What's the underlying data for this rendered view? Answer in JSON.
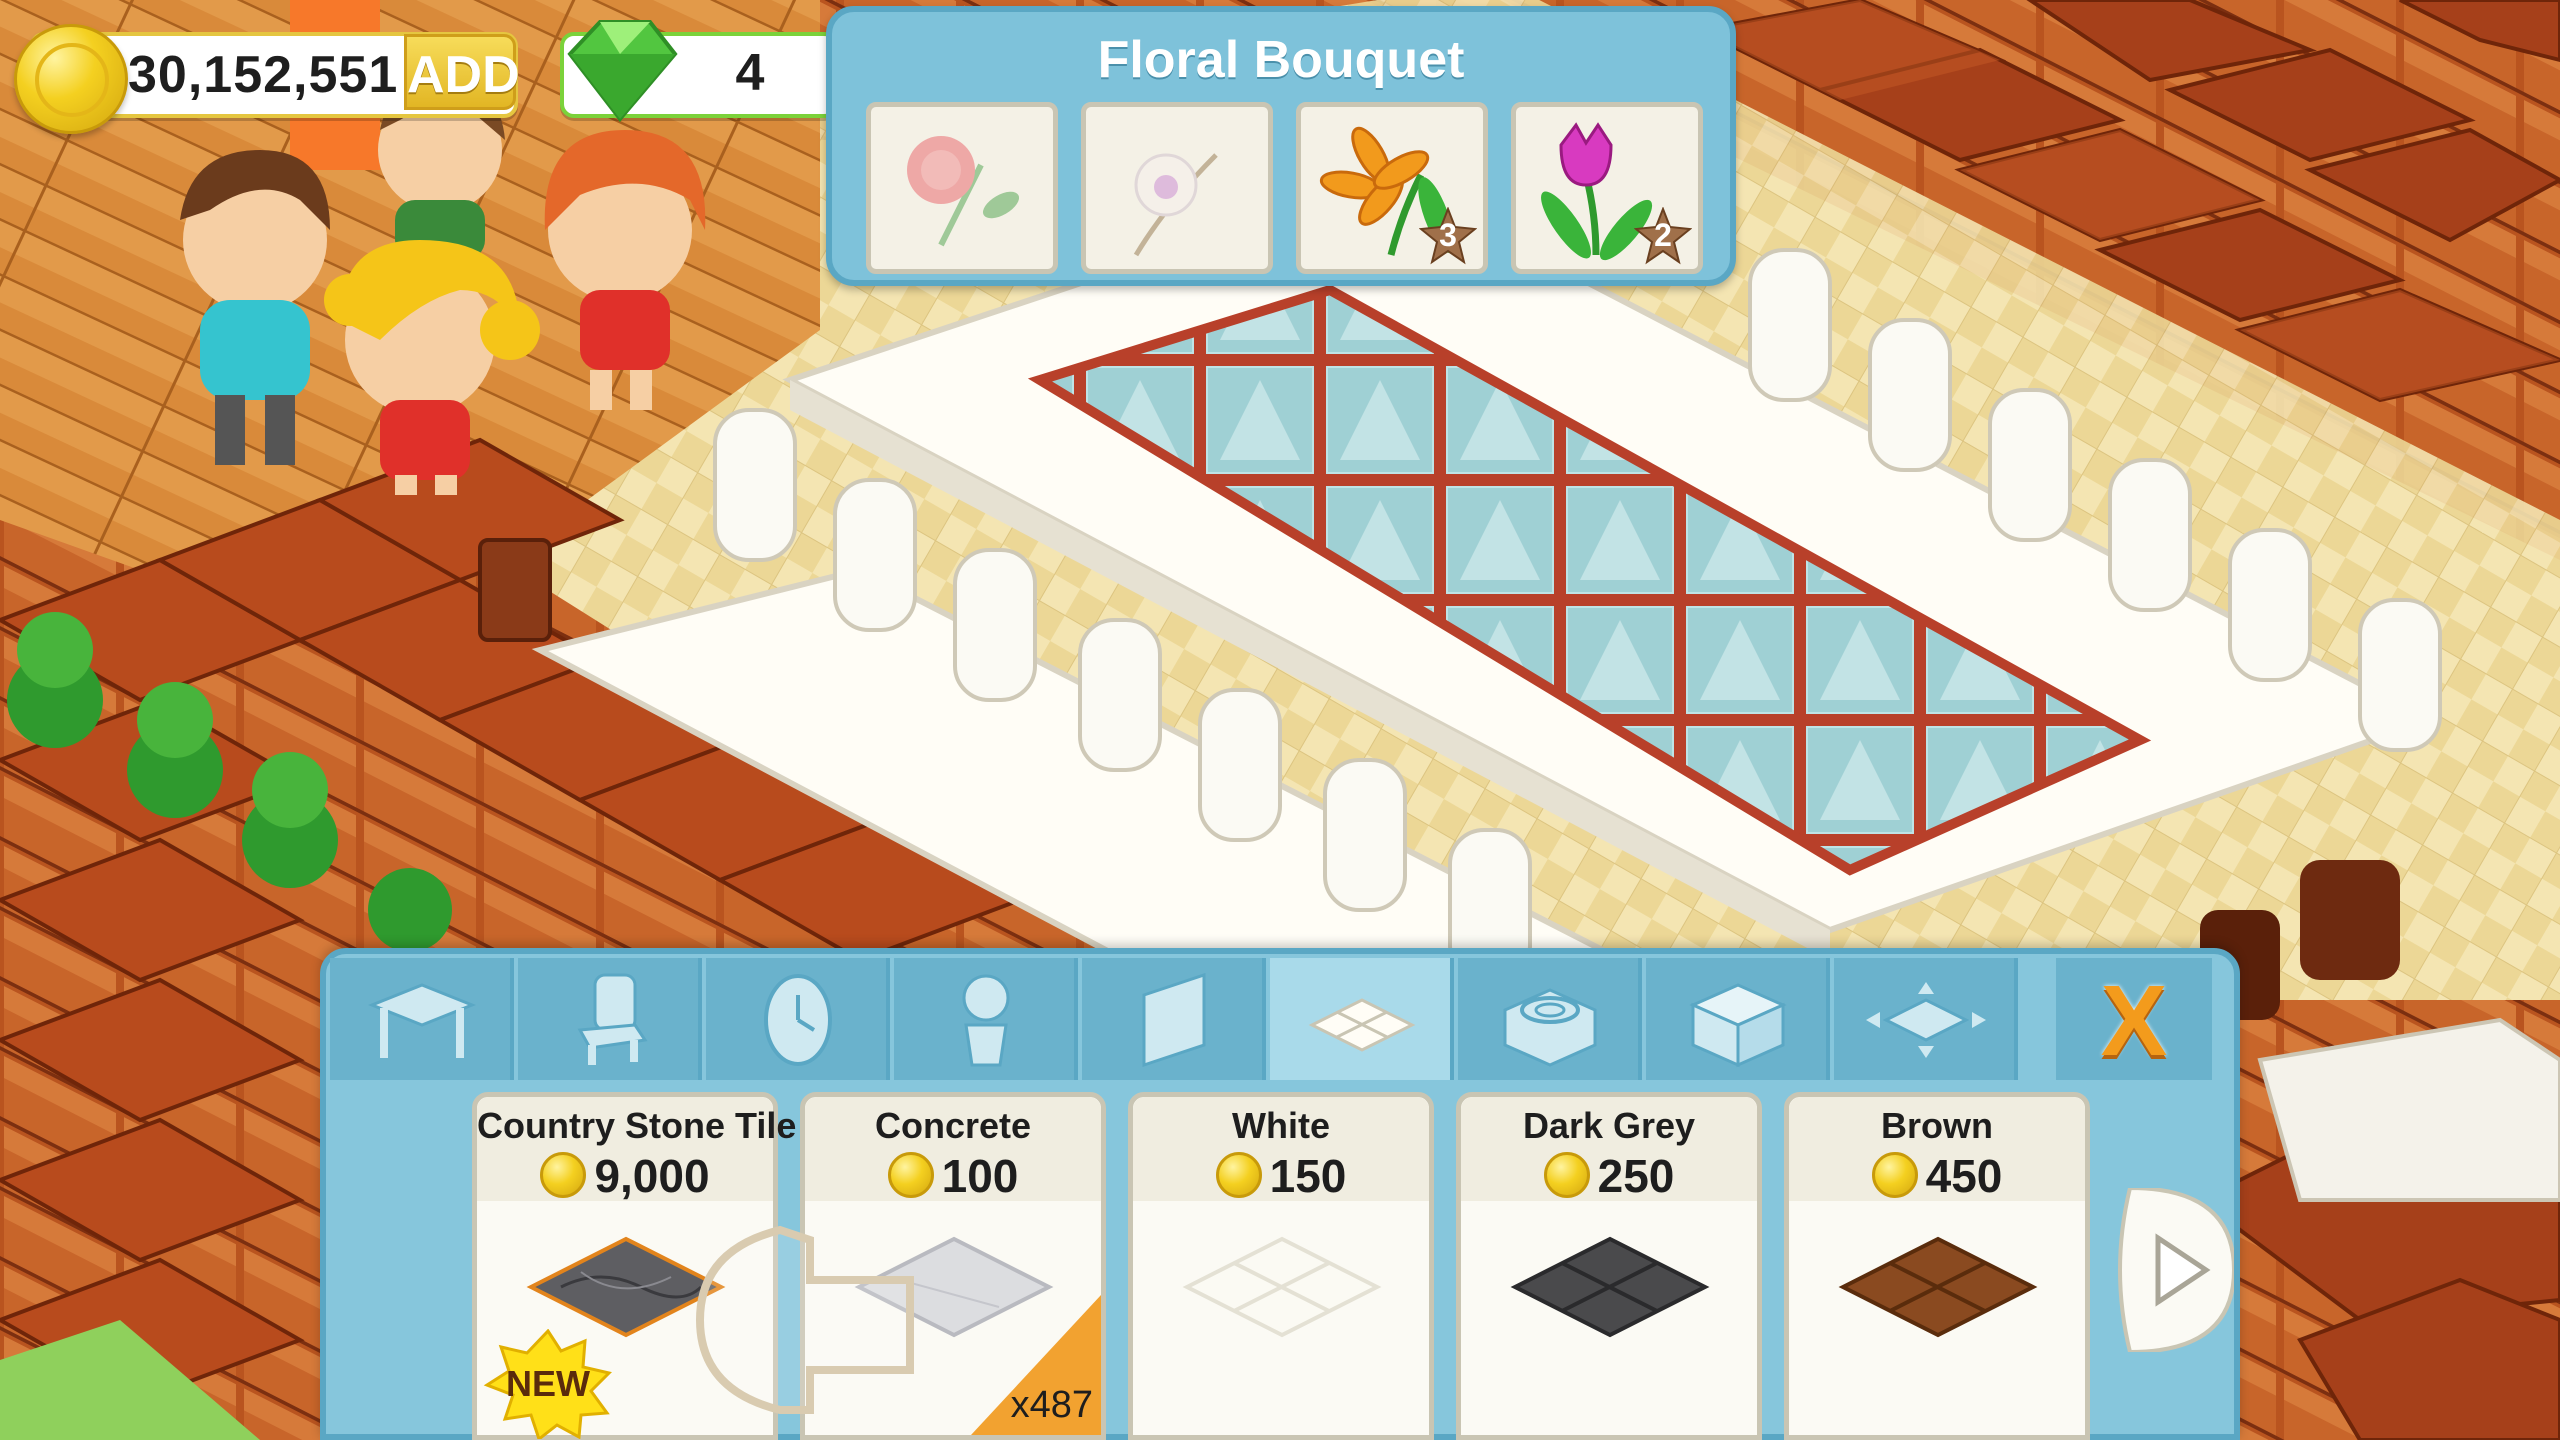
{
  "hud": {
    "coins": "30,152,551",
    "add_label": "ADD",
    "gems": "4"
  },
  "recipe": {
    "title": "Floral Bouquet",
    "ingredients": [
      {
        "icon": "rose-icon",
        "count": ""
      },
      {
        "icon": "orchid-icon",
        "count": ""
      },
      {
        "icon": "lily-icon",
        "count": "3"
      },
      {
        "icon": "tulip-icon",
        "count": "2"
      }
    ]
  },
  "build_panel": {
    "tabs": [
      {
        "icon": "table-icon"
      },
      {
        "icon": "chair-icon"
      },
      {
        "icon": "clock-icon"
      },
      {
        "icon": "plant-icon"
      },
      {
        "icon": "wall-icon"
      },
      {
        "icon": "floor-tile-icon",
        "active": true
      },
      {
        "icon": "stove-icon"
      },
      {
        "icon": "counter-icon"
      },
      {
        "icon": "expand-icon"
      }
    ],
    "close_label": "X",
    "items": [
      {
        "name": "Country Stone Tile",
        "price": "9,000",
        "badge": "NEW",
        "owned": ""
      },
      {
        "name": "Concrete",
        "price": "100",
        "badge": "",
        "owned": "x487"
      },
      {
        "name": "White",
        "price": "150",
        "badge": "",
        "owned": ""
      },
      {
        "name": "Dark Grey",
        "price": "250",
        "badge": "",
        "owned": ""
      },
      {
        "name": "Brown",
        "price": "450",
        "badge": "",
        "owned": ""
      }
    ]
  },
  "colors": {
    "panel_blue": "#86c6dc",
    "panel_border": "#5aa7c4",
    "coin_gold": "#f4d020",
    "close_orange": "#f39b1c",
    "floor_yellow": "#f1dfa6",
    "wood_tile": "#b9541f"
  }
}
